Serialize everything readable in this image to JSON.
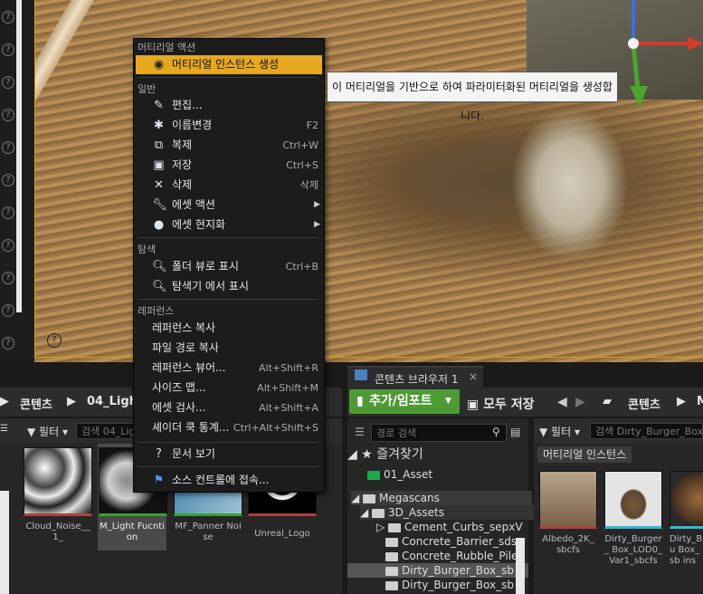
{
  "context_menu": {
    "section_material_actions": "머티리얼 액션",
    "create_material_instance": "머티리얼 인스턴스 생성",
    "section_general": "일반",
    "items_general": [
      {
        "label": "편집...",
        "shortcut": "",
        "icon": "edit-icon"
      },
      {
        "label": "이름변경",
        "shortcut": "F2",
        "icon": "rename-icon"
      },
      {
        "label": "복제",
        "shortcut": "Ctrl+W",
        "icon": "duplicate-icon"
      },
      {
        "label": "저장",
        "shortcut": "Ctrl+S",
        "icon": "save-icon"
      },
      {
        "label": "삭제",
        "shortcut": "삭제",
        "icon": "delete-icon"
      },
      {
        "label": "에셋 액션",
        "shortcut": "",
        "icon": "wrench-icon"
      },
      {
        "label": "에셋 현지화",
        "shortcut": "",
        "icon": "globe-icon"
      }
    ],
    "section_explore": "탐색",
    "items_explore": [
      {
        "label": "폴더 뷰로 표시",
        "shortcut": "Ctrl+B"
      },
      {
        "label": "탐색기 에서 표시",
        "shortcut": ""
      }
    ],
    "section_references": "레퍼런스",
    "items_references": [
      {
        "label": "레퍼런스 복사",
        "shortcut": ""
      },
      {
        "label": "파일 경로 복사",
        "shortcut": ""
      },
      {
        "label": "레퍼런스 뷰어...",
        "shortcut": "Alt+Shift+R"
      },
      {
        "label": "사이즈 맵...",
        "shortcut": "Alt+Shift+M"
      },
      {
        "label": "에셋 검사...",
        "shortcut": "Alt+Shift+A"
      },
      {
        "label": "셰이더 쿡 통계...",
        "shortcut": "Ctrl+Alt+Shift+S"
      }
    ],
    "docs": "문서 보기",
    "source_control": "소스 컨트롤에 접속..."
  },
  "tooltip": "이 머티리얼을 기반으로 하여 파라미터화된 머티리얼을 생성합니다.",
  "left_browser": {
    "breadcrumb_root": "콘텐츠",
    "breadcrumb_folder": "04_Ligh",
    "filter_label": "필터",
    "search_placeholder": "검색 04_Lig",
    "assets": [
      {
        "label": "Cloud_Noise__1_"
      },
      {
        "label": "M_Light Fucntion"
      },
      {
        "label": "MF_Panner Noise"
      },
      {
        "label": "Unreal_Logo"
      }
    ]
  },
  "right_browser": {
    "tab_title": "콘텐츠 브라우저 1",
    "add_import": "추가/임포트",
    "save_all": "모두 저장",
    "breadcrumb_root": "콘텐츠",
    "breadcrumb_next": "M",
    "path_search_placeholder": "경로 검색",
    "favorites": "즐겨찾기",
    "favorite_item": "01_Asset",
    "tree": [
      "Megascans",
      "3D_Assets",
      "Cement_Curbs_sepxV",
      "Concrete_Barrier_sds",
      "Concrete_Rubble_Pile",
      "Dirty_Burger_Box_sb",
      "Dirty_Burger_Box_sb"
    ],
    "filter_label": "필터",
    "search_placeholder": "검색 Dirty_Burger_Box_",
    "category_chip": "머티리얼 인스턴스",
    "assets": [
      {
        "label": "Albedo_2K_ sbcfs"
      },
      {
        "label": "Dirty_Burger_ Box_LOD0_ Var1_sbcfs"
      },
      {
        "label": "Dirty_Bu Box_sb ins"
      }
    ]
  },
  "colors": {
    "highlight": "#e5a820",
    "add_button": "#4e9a35",
    "frame": "#d4a017"
  }
}
